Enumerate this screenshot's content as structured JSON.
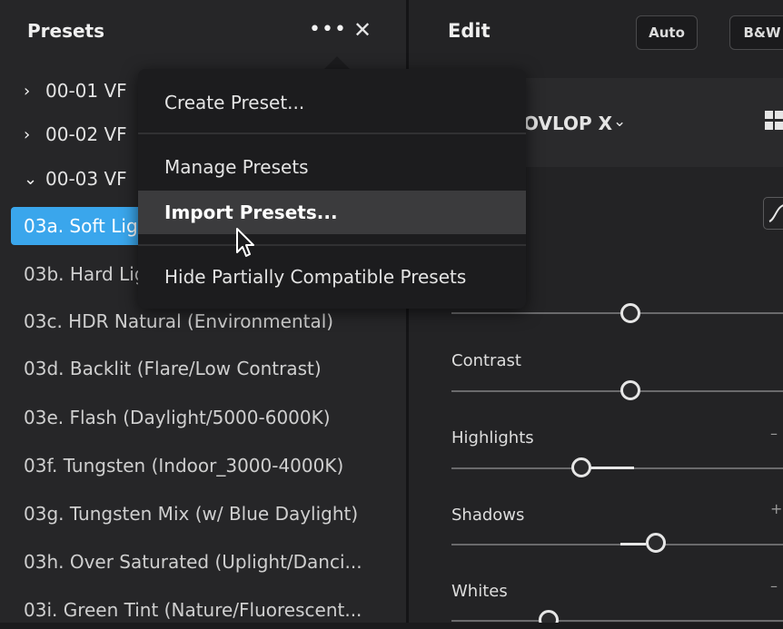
{
  "presets_panel": {
    "title": "Presets",
    "more_icon": "•••",
    "close_icon": "✕",
    "groups": [
      {
        "label": "00-01 VF",
        "expanded": false
      },
      {
        "label": "00-02 VF",
        "expanded": false
      },
      {
        "label": "00-03 VF",
        "expanded": true
      }
    ],
    "presets": [
      {
        "label": "03a. Soft Ligh",
        "selected": true
      },
      {
        "label": "03b. Hard Lig"
      },
      {
        "label": "03c. HDR Natural (Environmental)"
      },
      {
        "label": "03d. Backlit (Flare/Low Contrast)"
      },
      {
        "label": "03e. Flash (Daylight/5000-6000K)"
      },
      {
        "label": "03f. Tungsten (Indoor_3000-4000K)"
      },
      {
        "label": "03g. Tungsten Mix (w/ Blue Daylight)"
      },
      {
        "label": "03h. Over Saturated (Uplight/Danci..."
      },
      {
        "label": "03i. Green Tint (Nature/Fluorescent..."
      }
    ]
  },
  "context_menu": {
    "items": [
      {
        "label": "Create Preset..."
      },
      {
        "label": "Manage Presets"
      },
      {
        "label": "Import Presets...",
        "hovered": true
      },
      {
        "label": "Hide Partially Compatible Presets"
      }
    ]
  },
  "edit_panel": {
    "title": "Edit",
    "auto_label": "Auto",
    "bw_label": "B&W",
    "profile_label": "OVLOP X",
    "profile_chevron": "⌄",
    "sliders": [
      {
        "label": "",
        "value_fraction": 0.5
      },
      {
        "label": "Contrast",
        "value_fraction": 0.5
      },
      {
        "label": "Highlights",
        "value_fraction": 0.33
      },
      {
        "label": "Shadows",
        "value_fraction": 0.6
      },
      {
        "label": "Whites",
        "value_fraction": 0.3
      }
    ],
    "minus_mark": "–",
    "plus_mark": "+"
  },
  "colors": {
    "accent": "#3aa6ec",
    "panel": "#262628",
    "menu": "#1c1c1e"
  }
}
